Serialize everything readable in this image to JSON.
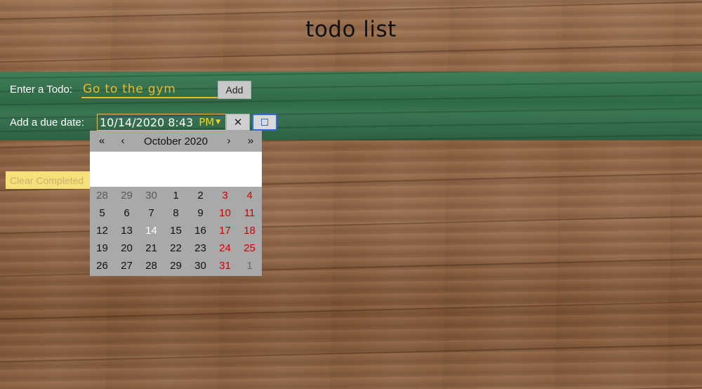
{
  "app": {
    "title": "todo list"
  },
  "todo": {
    "label": "Enter a Todo:",
    "input_value": "Go to the gym",
    "add_label": "Add"
  },
  "due": {
    "label": "Add a due date:",
    "value": "10/14/2020 8:43",
    "ampm": "PM",
    "clear_label": "✕"
  },
  "actions": {
    "clear_completed_label": "Clear Completed"
  },
  "calendar": {
    "prev_year": "«",
    "prev_month": "‹",
    "month_label": "October 2020",
    "next_month": "›",
    "next_year": "»",
    "days": [
      {
        "d": "28",
        "kind": "other"
      },
      {
        "d": "29",
        "kind": "other"
      },
      {
        "d": "30",
        "kind": "other"
      },
      {
        "d": "1",
        "kind": ""
      },
      {
        "d": "2",
        "kind": ""
      },
      {
        "d": "3",
        "kind": "weekend"
      },
      {
        "d": "4",
        "kind": "weekend"
      },
      {
        "d": "5",
        "kind": ""
      },
      {
        "d": "6",
        "kind": ""
      },
      {
        "d": "7",
        "kind": ""
      },
      {
        "d": "8",
        "kind": ""
      },
      {
        "d": "9",
        "kind": ""
      },
      {
        "d": "10",
        "kind": "weekend"
      },
      {
        "d": "11",
        "kind": "weekend"
      },
      {
        "d": "12",
        "kind": ""
      },
      {
        "d": "13",
        "kind": ""
      },
      {
        "d": "14",
        "kind": "today"
      },
      {
        "d": "15",
        "kind": ""
      },
      {
        "d": "16",
        "kind": ""
      },
      {
        "d": "17",
        "kind": "weekend"
      },
      {
        "d": "18",
        "kind": "weekend"
      },
      {
        "d": "19",
        "kind": ""
      },
      {
        "d": "20",
        "kind": ""
      },
      {
        "d": "21",
        "kind": ""
      },
      {
        "d": "22",
        "kind": ""
      },
      {
        "d": "23",
        "kind": ""
      },
      {
        "d": "24",
        "kind": "weekend"
      },
      {
        "d": "25",
        "kind": "weekend"
      },
      {
        "d": "26",
        "kind": ""
      },
      {
        "d": "27",
        "kind": ""
      },
      {
        "d": "28",
        "kind": ""
      },
      {
        "d": "29",
        "kind": ""
      },
      {
        "d": "30",
        "kind": ""
      },
      {
        "d": "31",
        "kind": "weekend"
      },
      {
        "d": "1",
        "kind": "other-weekend"
      }
    ]
  },
  "colors": {
    "band": "#2f6a47",
    "todo_text": "#f0b92a",
    "ampm": "#f2d020",
    "weekend": "#d00000",
    "calendar_bg": "#a9a9a9",
    "focus_ring": "#3b6ad0"
  }
}
